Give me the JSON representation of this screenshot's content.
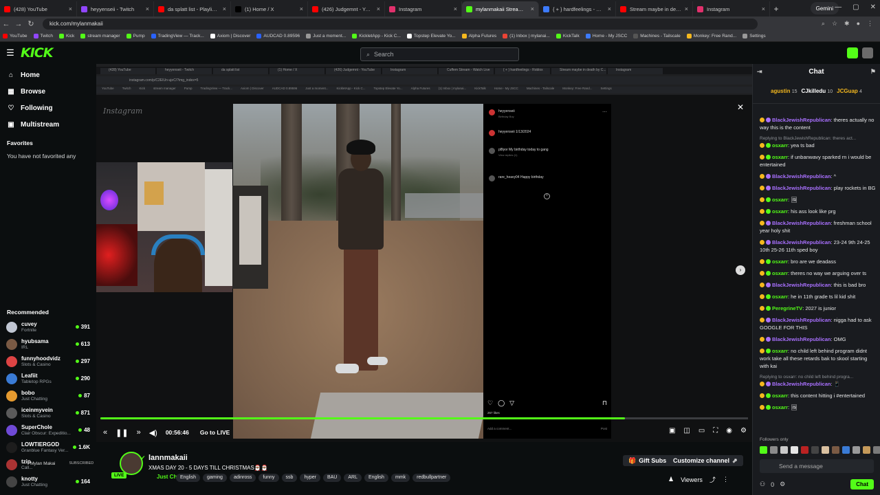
{
  "browser": {
    "tabs": [
      {
        "title": "(428) YouTube",
        "color": "#ff0000"
      },
      {
        "title": "heyyenseii - Twitch",
        "color": "#9146ff"
      },
      {
        "title": "da splatt list - Playlist - ...",
        "color": "#ff0000"
      },
      {
        "title": "(1) Home / X",
        "color": "#000000"
      },
      {
        "title": "(426) Judgemnt - YouTube",
        "color": "#ff0000"
      },
      {
        "title": "Instagram",
        "color": "#e1306c"
      },
      {
        "title": "mylanmakaii Stream - ...",
        "color": "#53fc18"
      },
      {
        "title": "{ + } hardfeelings - Roblox",
        "color": "#3d7bfd"
      },
      {
        "title": "Stream maybe in death by C...",
        "color": "#ff0000"
      },
      {
        "title": "Instagram",
        "color": "#e1306c"
      }
    ],
    "gemini_label": "Gemini",
    "url": "kick.com/mylanmakaii",
    "bookmarks": [
      {
        "label": "YouTube",
        "color": "#ff0000"
      },
      {
        "label": "Twitch",
        "color": "#9146ff"
      },
      {
        "label": "Kick",
        "color": "#53fc18"
      },
      {
        "label": "stream manager",
        "color": "#53fc18"
      },
      {
        "label": "Pump",
        "color": "#53fc18"
      },
      {
        "label": "TradingView — Track...",
        "color": "#2962ff"
      },
      {
        "label": "Axiom | Discover",
        "color": "#ffffff"
      },
      {
        "label": "AUDCAD 0.89596",
        "color": "#2962ff"
      },
      {
        "label": "Just a moment...",
        "color": "#999999"
      },
      {
        "label": "KickletApp - Kick C...",
        "color": "#53fc18"
      },
      {
        "label": "Topstep Elevate Yo...",
        "color": "#ffffff"
      },
      {
        "label": "Alpha Futures",
        "color": "#f5b81e"
      },
      {
        "label": "(1) Inbox | mylanai...",
        "color": "#ea4335"
      },
      {
        "label": "KickTalk",
        "color": "#53fc18"
      },
      {
        "label": "Home - My JSCC",
        "color": "#3d7bfd"
      },
      {
        "label": "Machines - Tailscale",
        "color": "#555555"
      },
      {
        "label": "Monkey: Free Rand...",
        "color": "#f5b81e"
      },
      {
        "label": "Settings",
        "color": "#999999"
      }
    ]
  },
  "kick": {
    "logo": "KICK",
    "search_placeholder": "Search",
    "nav": [
      {
        "label": "Home",
        "icon": "⌂"
      },
      {
        "label": "Browse",
        "icon": "▦"
      },
      {
        "label": "Following",
        "icon": "♡"
      },
      {
        "label": "Multistream",
        "icon": "▣"
      }
    ],
    "favorites_title": "Favorites",
    "favorites_empty": "You have not favorited any",
    "recommended_title": "Recommended",
    "recommended": [
      {
        "name": "cuvey",
        "category": "Fortnite",
        "viewers": "391",
        "color": "#c0c6d2"
      },
      {
        "name": "hyubsama",
        "category": "IRL",
        "viewers": "613",
        "color": "#7a5a44"
      },
      {
        "name": "funnyhoodvidz",
        "category": "Slots & Casino",
        "viewers": "297",
        "color": "#d44"
      },
      {
        "name": "Leafiit",
        "category": "Tabletop RPGs",
        "viewers": "290",
        "color": "#3a7bd5"
      },
      {
        "name": "bobo",
        "category": "Just Chatting",
        "viewers": "87",
        "color": "#e59a2f"
      },
      {
        "name": "iceinmyvein",
        "category": "Slots & Casino",
        "viewers": "871",
        "color": "#5a5a5a"
      },
      {
        "name": "SuperChole",
        "category": "Clair Obscur: Expeditio...",
        "viewers": "48",
        "color": "#6f4ad6"
      },
      {
        "name": "LOWTIERGOD",
        "category": "Granblue Fantasy Ver...",
        "viewers": "1.6K",
        "color": "#1d1d1d"
      },
      {
        "name": "tzip",
        "category": "Call...",
        "viewers": "",
        "color": "#a33"
      },
      {
        "name": "knotty",
        "category": "Just Chatting",
        "viewers": "164",
        "color": "#444"
      }
    ],
    "mini_profile": {
      "name": "Mylan Makai",
      "status": "SUBSCRIBED"
    }
  },
  "player": {
    "inner_tabs": [
      "(428) YouTube",
      "heyyenseii - Twitch",
      "da splatt list",
      "(1) Home / X",
      "(426) Judgemnt - YouTube",
      "Instagram",
      "Cuffem Stream - Watch Live",
      "{ + } hardfeelings - Roblox",
      "Stream maybe in death by C...",
      "Instagram"
    ],
    "inner_url": "instagram.com/p/C2EIUn-ujeC/?img_index=5",
    "inner_bookmarks": [
      "YouTube",
      "Twitch",
      "Kick",
      "stream manager",
      "Pump",
      "TradingView — Track...",
      "Axiom | Discover",
      "AUDCAD 0.89596",
      "Just a moment...",
      "KickletApp - Kick C...",
      "Topstep Elevate Yo...",
      "Alpha Futures",
      "(1) Inbox | mylanai...",
      "KickTalk",
      "Home - My JSCC",
      "Machines - Tailscale",
      "Monkey: Free Rand...",
      "Settings"
    ],
    "ig_logo": "Instagram",
    "ig_post": {
      "user": "heyyenseii",
      "subtitle": "Birthday Boy",
      "caption_user": "heyyenseii",
      "caption_date": "1/13/2024",
      "comments": [
        {
          "user": "p8lyor",
          "text": "My birthday today to gang",
          "meta": "View replies (1)"
        },
        {
          "user": "rare_heavy04",
          "text": "Happy birthday",
          "meta": ""
        }
      ],
      "likes": "267 likes",
      "add_comment": "Add a comment...",
      "post_label": "Post"
    },
    "time": "00:56:46",
    "go_live": "Go to LIVE",
    "progress": 0.81
  },
  "stream": {
    "name": "lannmakaii",
    "title": "XMAS DAY 20 - 5 DAYS TILL CHRISTMAS🎅🏾🎅🏾",
    "live_label": "LIVE",
    "category": "Just Chatting",
    "tags": [
      "English",
      "gaming",
      "adinross",
      "funny",
      "ssb",
      "hyper",
      "BAU",
      "ARL",
      "English",
      "mmk",
      "redbullpartner"
    ],
    "gift_subs": "Gift Subs",
    "customize": "Customize channel",
    "viewers_label": "Viewers"
  },
  "chat": {
    "title": "Chat",
    "pinned": [
      {
        "user": "agustin",
        "count": "15"
      },
      {
        "user": "CJkilledu",
        "count": "10"
      },
      {
        "user": "JCGuap",
        "count": "4"
      }
    ],
    "messages": [
      {
        "type": "msg",
        "user": "BlackJewishRepublican",
        "color": "#a970ff",
        "text": "theres actually no way this is the content"
      },
      {
        "type": "reply",
        "text": "Replying to BlackJewishRepublican: theres act..."
      },
      {
        "type": "msg",
        "user": "osxarr",
        "color": "#53fc18",
        "text": "yea ts bad"
      },
      {
        "type": "msg",
        "user": "osxarr",
        "color": "#53fc18",
        "text": "if unbanwavy sparked rn i would be entertained"
      },
      {
        "type": "msg",
        "user": "BlackJewishRepublican",
        "color": "#a970ff",
        "text": "^"
      },
      {
        "type": "msg",
        "user": "BlackJewishRepublican",
        "color": "#a970ff",
        "text": "play rockets in BG"
      },
      {
        "type": "msg",
        "user": "osxarr",
        "color": "#53fc18",
        "text": "🖼"
      },
      {
        "type": "msg",
        "user": "osxarr",
        "color": "#53fc18",
        "text": "his ass look like prg"
      },
      {
        "type": "msg",
        "user": "BlackJewishRepublican",
        "color": "#a970ff",
        "text": "freshman school year holy shit"
      },
      {
        "type": "msg",
        "user": "BlackJewishRepublican",
        "color": "#a970ff",
        "text": "23-24 9th 24-25 10th 25-26 11th sped boy"
      },
      {
        "type": "msg",
        "user": "osxarr",
        "color": "#53fc18",
        "text": "bro are we deadass"
      },
      {
        "type": "msg",
        "user": "osxarr",
        "color": "#53fc18",
        "text": "theres no way we arguing over ts"
      },
      {
        "type": "msg",
        "user": "BlackJewishRepublican",
        "color": "#a970ff",
        "text": "this is bad bro"
      },
      {
        "type": "msg",
        "user": "osxarr",
        "color": "#53fc18",
        "text": "he in 11th grade ts lil kid shit"
      },
      {
        "type": "msg",
        "user": "PeregrineTV",
        "color": "#53fc18",
        "text": "2027 is junior"
      },
      {
        "type": "msg",
        "user": "BlackJewishRepublican",
        "color": "#a970ff",
        "text": "nigga had to ask GOOGLE FOR THIS"
      },
      {
        "type": "msg",
        "user": "BlackJewishRepublican",
        "color": "#a970ff",
        "text": "OMG"
      },
      {
        "type": "msg",
        "user": "osxarr",
        "color": "#53fc18",
        "text": "no child left behind program didnt work take all these retards bak to skool starting with kai"
      },
      {
        "type": "reply",
        "text": "Replying to osxarr: no child left behind progra..."
      },
      {
        "type": "msg",
        "user": "BlackJewishRepublican",
        "color": "#a970ff",
        "text": "📱"
      },
      {
        "type": "msg",
        "user": "osxarr",
        "color": "#53fc18",
        "text": "this content hitting i #entertained"
      },
      {
        "type": "msg",
        "user": "osxarr",
        "color": "#53fc18",
        "text": "🖼"
      }
    ],
    "followers_only": "Followers only",
    "send_placeholder": "Send a message",
    "count": "0",
    "chat_button": "Chat"
  }
}
